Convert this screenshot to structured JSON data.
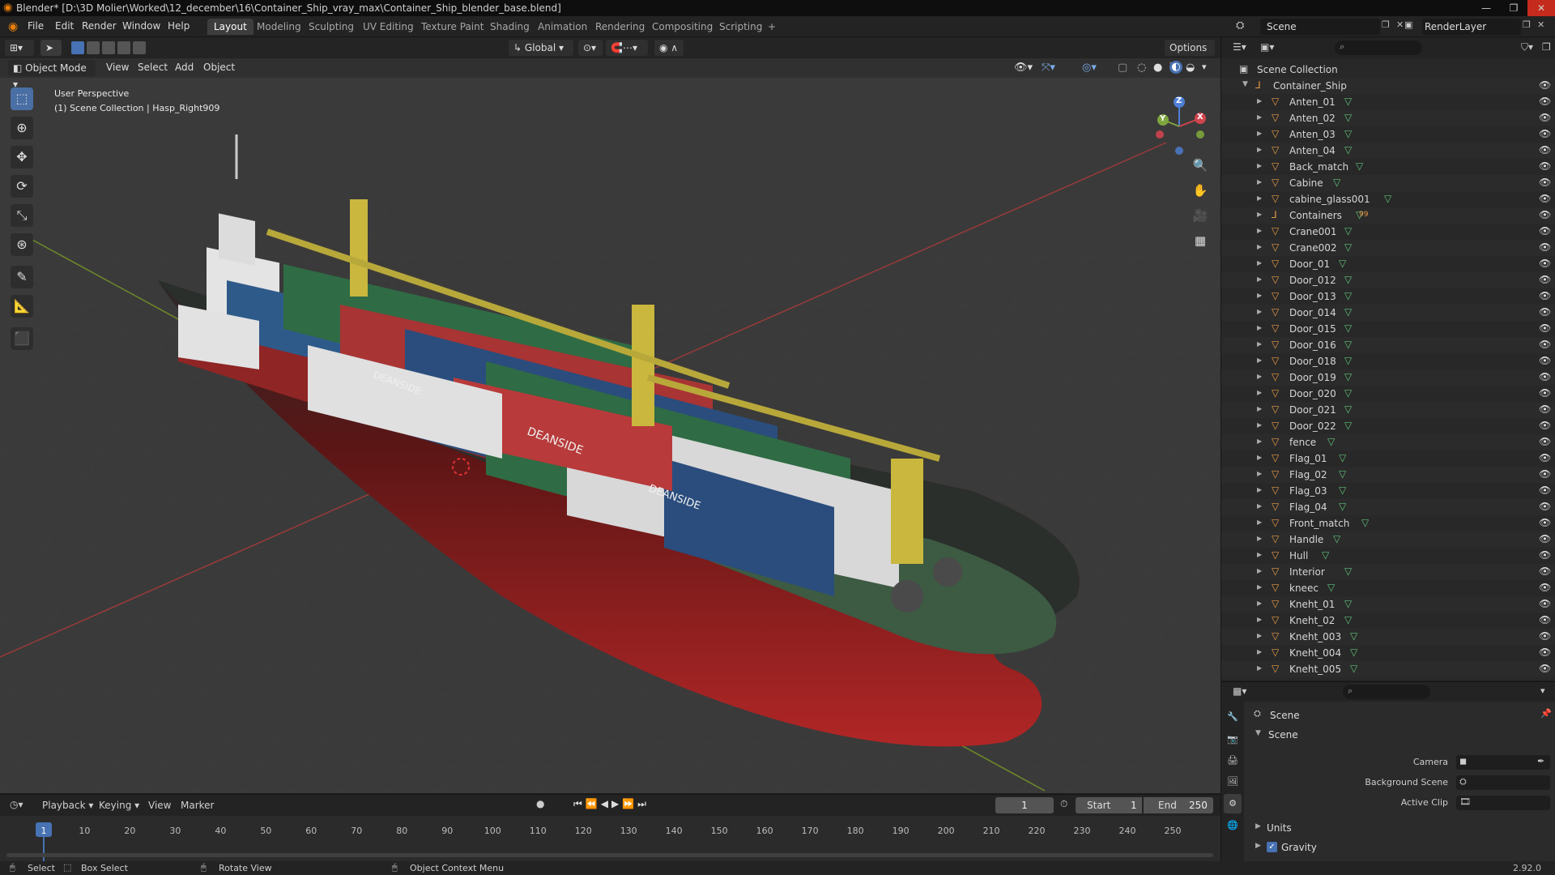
{
  "titlebar": {
    "title": "Blender* [D:\\3D Molier\\Worked\\12_december\\16\\Container_Ship_vray_max\\Container_Ship_blender_base.blend]",
    "minimize": "—",
    "maximize": "❐",
    "close": "✕"
  },
  "menu": {
    "items": [
      "File",
      "Edit",
      "Render",
      "Window",
      "Help"
    ],
    "workspaces": [
      "Layout",
      "Modeling",
      "Sculpting",
      "UV Editing",
      "Texture Paint",
      "Shading",
      "Animation",
      "Rendering",
      "Compositing",
      "Scripting"
    ],
    "active_workspace": "Layout",
    "add_tab": "+",
    "scene_label": "Scene",
    "render_layer_label": "RenderLayer"
  },
  "viewport": {
    "mode": "Object Mode",
    "menus": [
      "View",
      "Select",
      "Add",
      "Object"
    ],
    "transform_orientation": "Global",
    "options_label": "Options",
    "info_line1": "User Perspective",
    "info_line2": "(1) Scene Collection | Hasp_Right909",
    "gizmo_x": "X",
    "gizmo_y": "Y",
    "gizmo_z": "Z",
    "container_text": "DEANSIDE"
  },
  "outliner": {
    "root": "Scene Collection",
    "collection": "Container_Ship",
    "items": [
      "Anten_01",
      "Anten_02",
      "Anten_03",
      "Anten_04",
      "Back_match",
      "Cabine",
      "cabine_glass001",
      "Containers",
      "Crane001",
      "Crane002",
      "Door_01",
      "Door_012",
      "Door_013",
      "Door_014",
      "Door_015",
      "Door_016",
      "Door_018",
      "Door_019",
      "Door_020",
      "Door_021",
      "Door_022",
      "fence",
      "Flag_01",
      "Flag_02",
      "Flag_03",
      "Flag_04",
      "Front_match",
      "Handle",
      "Hull",
      "Interior",
      "kneec",
      "Kneht_01",
      "Kneht_02",
      "Kneht_003",
      "Kneht_004",
      "Kneht_005"
    ],
    "containers_badge": "99",
    "search_icon": "search-icon",
    "filter_icon": "filter-icon"
  },
  "properties": {
    "context_title": "Scene",
    "panel_title": "Scene",
    "camera_label": "Camera",
    "bg_scene_label": "Background Scene",
    "active_clip_label": "Active Clip",
    "units_label": "Units",
    "gravity_label": "Gravity",
    "gravity_checked": true,
    "version": "2.92.0"
  },
  "timeline": {
    "menus": [
      "Playback",
      "Keying",
      "View",
      "Marker"
    ],
    "current_frame": "1",
    "start_label": "Start",
    "start_value": "1",
    "end_label": "End",
    "end_value": "250",
    "ticks": [
      "1",
      "10",
      "20",
      "30",
      "40",
      "50",
      "60",
      "70",
      "80",
      "90",
      "100",
      "110",
      "120",
      "130",
      "140",
      "150",
      "160",
      "170",
      "180",
      "190",
      "200",
      "210",
      "220",
      "230",
      "240",
      "250"
    ]
  },
  "status": {
    "select": "Select",
    "box_select": "Box Select",
    "rotate_view": "Rotate View",
    "context_menu": "Object Context Menu"
  },
  "colors": {
    "accent": "#4772b3",
    "hull_red": "#8e1f1f",
    "crane_yellow": "#c9b73e",
    "deck_green": "#3d5a43"
  }
}
